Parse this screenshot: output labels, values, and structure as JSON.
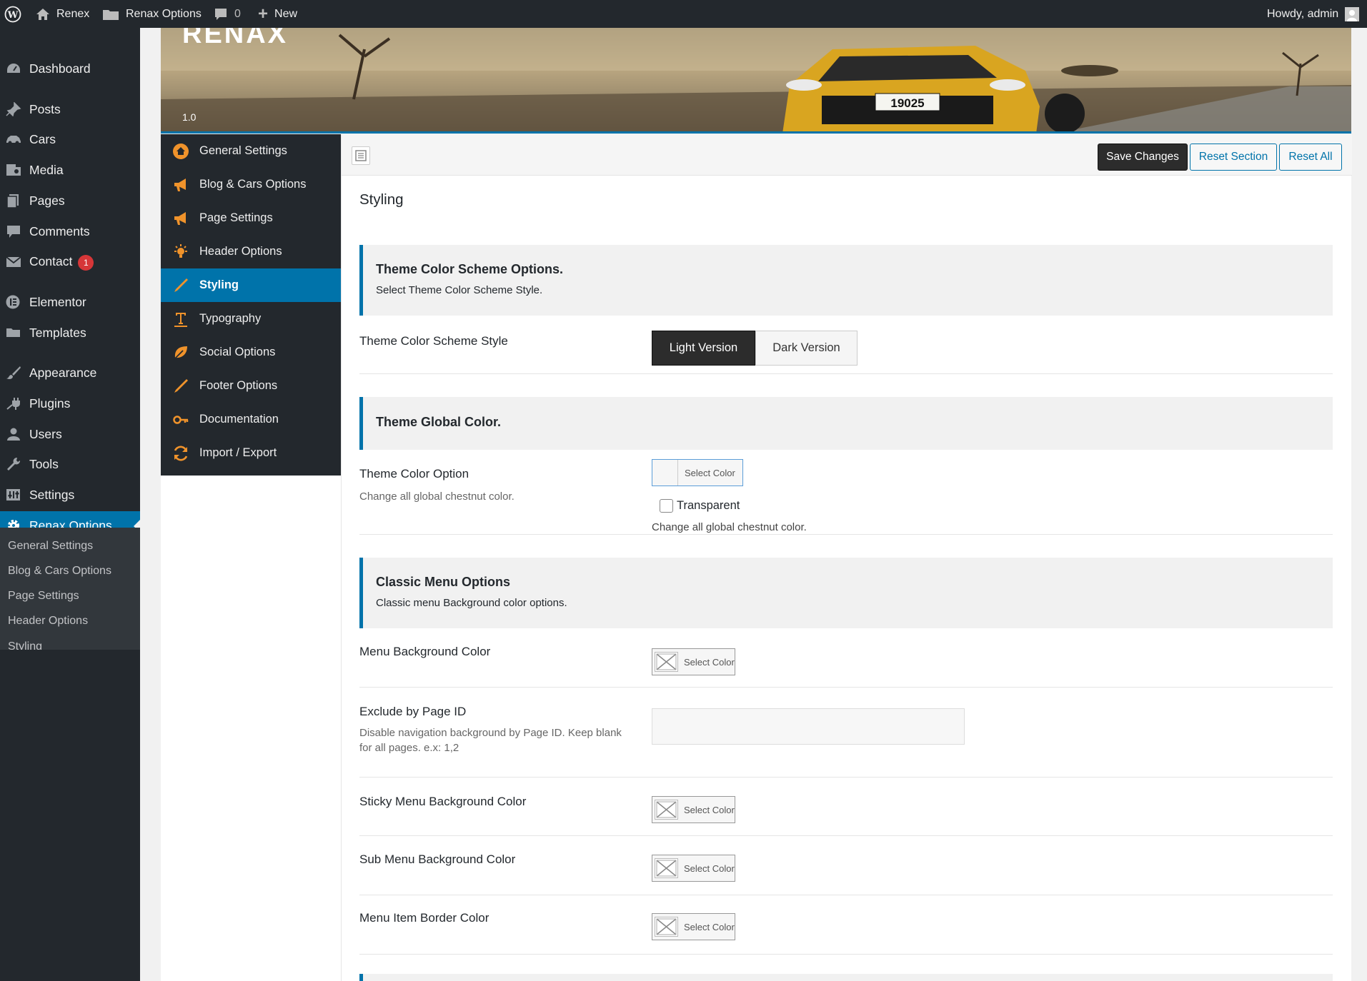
{
  "adminbar": {
    "site": "Renex",
    "options": "Renax Options",
    "comments": "0",
    "new": "New",
    "howdy": "Howdy, admin"
  },
  "sidebar": {
    "items": [
      {
        "label": "Dashboard",
        "icon": "dashboard-icon"
      },
      {
        "label": "Posts",
        "icon": "pin-icon"
      },
      {
        "label": "Cars",
        "icon": "car-icon"
      },
      {
        "label": "Media",
        "icon": "media-icon"
      },
      {
        "label": "Pages",
        "icon": "pages-icon"
      },
      {
        "label": "Comments",
        "icon": "comment-icon"
      },
      {
        "label": "Contact",
        "icon": "mail-icon",
        "badge": "1"
      },
      {
        "label": "Elementor",
        "icon": "elementor-icon"
      },
      {
        "label": "Templates",
        "icon": "folder-icon"
      },
      {
        "label": "Appearance",
        "icon": "brush-icon"
      },
      {
        "label": "Plugins",
        "icon": "plugin-icon"
      },
      {
        "label": "Users",
        "icon": "user-icon"
      },
      {
        "label": "Tools",
        "icon": "wrench-icon"
      },
      {
        "label": "Settings",
        "icon": "settings-icon"
      },
      {
        "label": "Renax Options",
        "icon": "gear-icon"
      }
    ],
    "submenu": [
      "General Settings",
      "Blog & Cars Options",
      "Page Settings",
      "Header Options",
      "Styling"
    ]
  },
  "header": {
    "logo": "RENAX",
    "version": "1.0",
    "plate": "19025"
  },
  "tabs": [
    {
      "label": "General Settings",
      "icon": "home-icon"
    },
    {
      "label": "Blog & Cars Options",
      "icon": "megaphone-icon"
    },
    {
      "label": "Page Settings",
      "icon": "megaphone-icon"
    },
    {
      "label": "Header Options",
      "icon": "lightbulb-icon"
    },
    {
      "label": "Styling",
      "icon": "pencil-icon"
    },
    {
      "label": "Typography",
      "icon": "text-icon"
    },
    {
      "label": "Social Options",
      "icon": "leaf-icon"
    },
    {
      "label": "Footer Options",
      "icon": "pencil-icon"
    },
    {
      "label": "Documentation",
      "icon": "key-icon"
    },
    {
      "label": "Import / Export",
      "icon": "refresh-icon"
    }
  ],
  "toolbar": {
    "save": "Save Changes",
    "reset_section": "Reset Section",
    "reset_all": "Reset All"
  },
  "page_title": "Styling",
  "sections": {
    "scheme": {
      "title": "Theme Color Scheme Options.",
      "desc": "Select Theme Color Scheme Style."
    },
    "global": {
      "title": "Theme Global Color."
    },
    "classic": {
      "title": "Classic Menu Options",
      "desc": "Classic menu Background color options."
    }
  },
  "fields": {
    "scheme_style": {
      "label": "Theme Color Scheme Style",
      "options": [
        "Light Version",
        "Dark Version"
      ],
      "selected": "Light Version"
    },
    "theme_color": {
      "label": "Theme Color Option",
      "desc": "Change all global chestnut color.",
      "button": "Select Color",
      "transparent": "Transparent",
      "note": "Change all global chestnut color."
    },
    "menu_bg": {
      "label": "Menu Background Color",
      "button": "Select Color"
    },
    "exclude": {
      "label": "Exclude by Page ID",
      "desc1": "Disable navigation background by Page ID. Keep blank",
      "desc2": "for all pages. e.x: 1,2",
      "value": ""
    },
    "sticky_bg": {
      "label": "Sticky Menu Background Color",
      "button": "Select Color"
    },
    "sub_bg": {
      "label": "Sub Menu Background Color",
      "button": "Select Color"
    },
    "border": {
      "label": "Menu Item Border Color",
      "button": "Select Color"
    }
  },
  "colors": {
    "accent": "#0073aa",
    "admin_dark": "#23282d",
    "badge": "#d63638",
    "brand_orange": "#f0932b"
  }
}
